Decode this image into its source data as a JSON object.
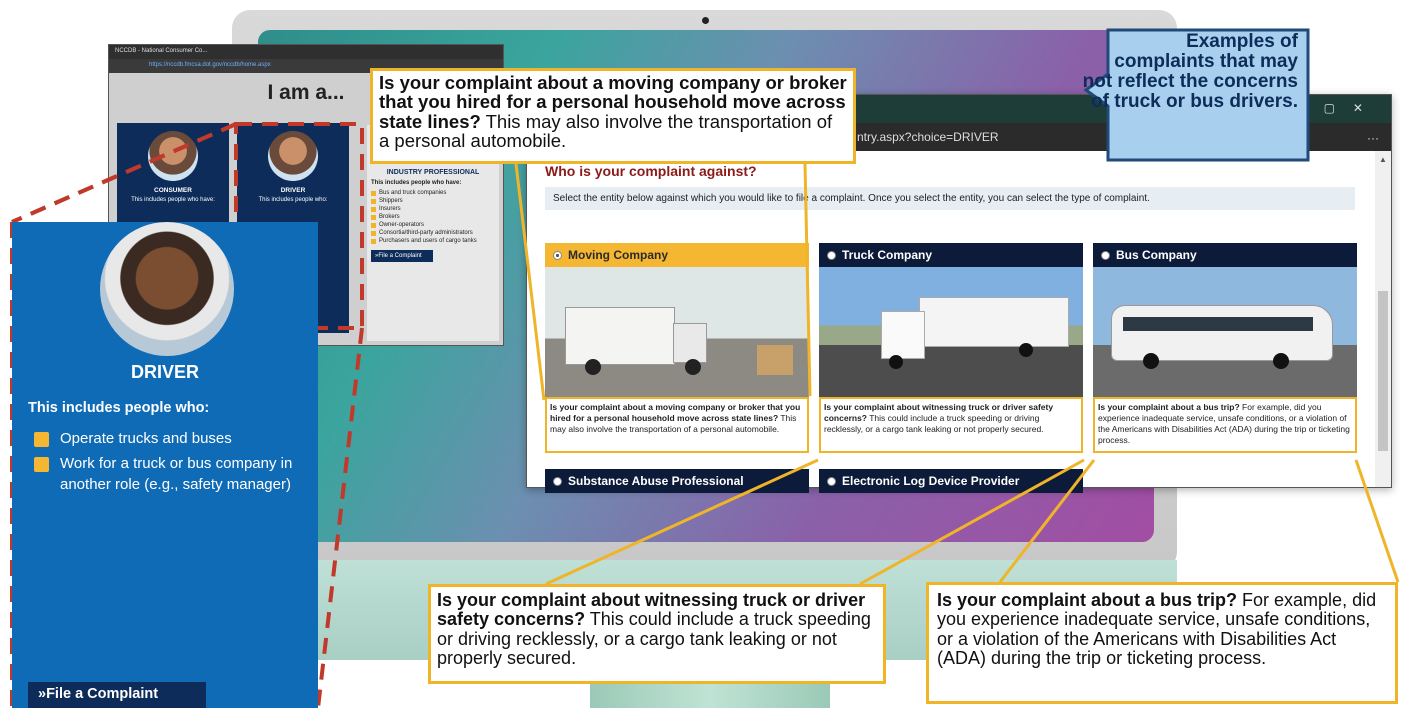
{
  "back_window": {
    "tab_title": "NCCDB - National Consumer Co...",
    "url": "https://nccdb.fmcsa.dot.gov/nccdb/home.aspx",
    "heading": "I am a...",
    "consumer": {
      "title": "CONSUMER",
      "sub": "This includes people who have:"
    },
    "driver": {
      "title": "DRIVER",
      "sub": "This includes people who:"
    },
    "industry": {
      "title": "INDUSTRY PROFESSIONAL",
      "sub": "This includes people who have:",
      "items": [
        "Bus and truck companies",
        "Shippers",
        "Insurers",
        "Brokers",
        "Owner-operators",
        "Consortia/third-party administrators",
        "Purchasers and users of cargo tanks"
      ],
      "button": "»File a Complaint"
    }
  },
  "front_window": {
    "url_fragment": "ntry.aspx?choice=DRIVER",
    "question": "Who is your complaint against?",
    "instructions": "Select the entity below against which you would like to file a complaint. Once you select the entity, you can select the type of complaint.",
    "entities": [
      {
        "label": "Moving Company",
        "selected": true,
        "desc_bold": "Is your complaint about a moving company or broker that you hired for a personal household move across state lines?",
        "desc": " This may also involve the transportation of a personal automobile."
      },
      {
        "label": "Truck Company",
        "selected": false,
        "desc_bold": "Is your complaint about witnessing truck or driver safety concerns?",
        "desc": " This could include a truck speeding or driving recklessly, or a cargo tank leaking or not properly secured."
      },
      {
        "label": "Bus Company",
        "selected": false,
        "desc_bold": "Is your complaint about a bus trip?",
        "desc": " For example, did you experience inadequate service, unsafe conditions, or a violation of the Americans with Disabilities Act (ADA) during the trip or ticketing process."
      },
      {
        "label": "Substance Abuse Professional",
        "selected": false
      },
      {
        "label": "Electronic Log Device Provider",
        "selected": false
      }
    ]
  },
  "driver_card": {
    "title": "DRIVER",
    "sub": "This includes people who:",
    "items": [
      "Operate trucks and buses",
      "Work for a truck or bus company in another role (e.g., safety manager)"
    ],
    "button": "»File a Complaint"
  },
  "callouts": {
    "moving": {
      "bold": "Is your complaint about a moving company or broker that you hired for a personal household move across state lines?",
      "rest": " This may also involve the transportation of a personal automobile."
    },
    "truck": {
      "bold": "Is your complaint about witnessing truck or driver safety concerns?",
      "rest": " This could include a truck speeding or driving recklessly, or a cargo tank leaking or not properly secured."
    },
    "bus": {
      "bold": "Is your complaint about a bus trip?",
      "rest": " For example, did you experience inadequate service, unsafe conditions, or a violation of the Americans with Disabilities Act (ADA) during the trip or ticketing process."
    },
    "examples": "Examples of complaints that may not reflect the concerns of truck or bus drivers."
  },
  "colors": {
    "navy": "#0d1b3a",
    "driver_blue": "#0f6bb6",
    "gold": "#f0b429",
    "dashed_red": "#c0392b"
  }
}
